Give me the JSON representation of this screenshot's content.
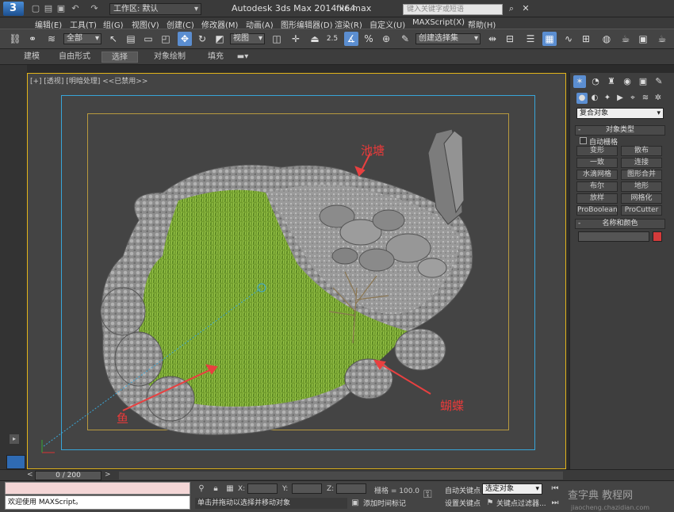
{
  "titlebar": {
    "workspace": "工作区: 默认",
    "app_title": "Autodesk 3ds Max  2014 x64",
    "file_title": "file.max",
    "search_placeholder": "键入关键字或短语"
  },
  "menus": [
    "编辑(E)",
    "工具(T)",
    "组(G)",
    "视图(V)",
    "创建(C)",
    "修改器(M)",
    "动画(A)",
    "图形编辑器(D)",
    "渲染(R)",
    "自定义(U)",
    "MAXScript(X)",
    "帮助(H)"
  ],
  "toolbar": {
    "selection_filter": "全部",
    "ref_coord": "视图",
    "named_selection": "创建选择集",
    "snap_value": "2.5"
  },
  "ribbon_tabs": [
    "建模",
    "自由形式",
    "选择",
    "对象绘制",
    "填充"
  ],
  "ribbon_active": "选择",
  "viewport": {
    "label": "[+] [透视] [明暗处理] <<已禁用>>",
    "annotations": {
      "pond": "池塘",
      "fish": "鱼",
      "butterfly": "蝴蝶"
    }
  },
  "command_panel": {
    "category": "复合对象",
    "object_type_header": "对象类型",
    "auto_grid": "自动栅格",
    "buttons": [
      "变形",
      "散布",
      "一致",
      "连接",
      "水滴网格",
      "图形合并",
      "布尔",
      "地形",
      "放样",
      "网格化",
      "ProBoolean",
      "ProCutter"
    ],
    "name_color_header": "名称和颜色",
    "swatch_color": "#d43b3b"
  },
  "timeline": {
    "frame_readout": "0 / 200"
  },
  "statusbar": {
    "maxscript_welcome": "欢迎使用 MAXScript。",
    "x_label": "X:",
    "y_label": "Y:",
    "z_label": "Z:",
    "grid": "栅格 = 100.0",
    "prompt": "单击并拖动以选择并移动对象",
    "add_time_tag": "添加时间标记",
    "auto_key": "自动关键点",
    "set_key": "设置关键点",
    "selected": "选定对象",
    "key_filters": "关键点过滤器..."
  },
  "watermark": {
    "main": "查字典 教程网",
    "sub": "jiaocheng.chazidian.com"
  }
}
